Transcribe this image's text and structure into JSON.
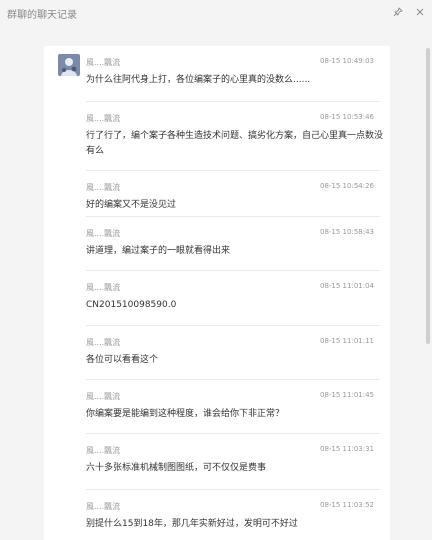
{
  "window": {
    "title": "群聊的聊天记录"
  },
  "messages": [
    {
      "sender": "風....飄流",
      "time": "08-15 10:49:03",
      "text": "为什么往阿代身上打，各位编案子的心里真的没数么......",
      "avatar": true
    },
    {
      "sender": "風....飄流",
      "time": "08-15 10:53:46",
      "text": "行了行了，编个案子各种生造技术问题、搞劣化方案，自己心里真一点数没有么",
      "avatar": false
    },
    {
      "sender": "風....飄流",
      "time": "08-15 10:54:26",
      "text": "好的编案又不是没见过",
      "avatar": false
    },
    {
      "sender": "風....飄流",
      "time": "08-15 10:58:43",
      "text": "讲道理，编过案子的一眼就看得出来",
      "avatar": false
    },
    {
      "sender": "風....飄流",
      "time": "08-15 11:01:04",
      "text": "CN201510098590.0",
      "avatar": false
    },
    {
      "sender": "風....飄流",
      "time": "08-15 11:01:11",
      "text": "各位可以看看这个",
      "avatar": false
    },
    {
      "sender": "風....飄流",
      "time": "08-15 11:01:45",
      "text": "你编案要是能编到这种程度，谁会给你下非正常？",
      "avatar": false
    },
    {
      "sender": "風....飄流",
      "time": "08-15 11:03:31",
      "text": "六十多张标准机械制图图纸，可不仅仅是费事",
      "avatar": false
    },
    {
      "sender": "風....飄流",
      "time": "08-15 11:03:52",
      "text": "别提什么15到18年，那几年实新好过，发明可不好过",
      "avatar": false
    }
  ]
}
